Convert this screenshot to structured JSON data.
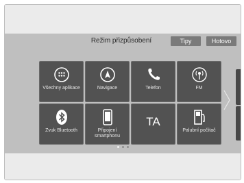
{
  "header": {
    "title": "Režim přizpůsobení",
    "tips_label": "Tipy",
    "done_label": "Hotovo"
  },
  "tiles": [
    {
      "label": "Všechny aplikace",
      "icon": "all-apps-icon"
    },
    {
      "label": "Navigace",
      "icon": "navigation-icon"
    },
    {
      "label": "Telefon",
      "icon": "phone-icon"
    },
    {
      "label": "FM",
      "icon": "radio-icon"
    },
    {
      "label": "Zvuk Bluetooth",
      "icon": "bluetooth-icon"
    },
    {
      "label": "Připojení smartphonu",
      "icon": "smartphone-icon"
    },
    {
      "label": "TA",
      "icon": ""
    },
    {
      "label": "Palubní počítač",
      "icon": "trip-computer-icon"
    }
  ],
  "pager": {
    "total": 3,
    "active": 0
  }
}
